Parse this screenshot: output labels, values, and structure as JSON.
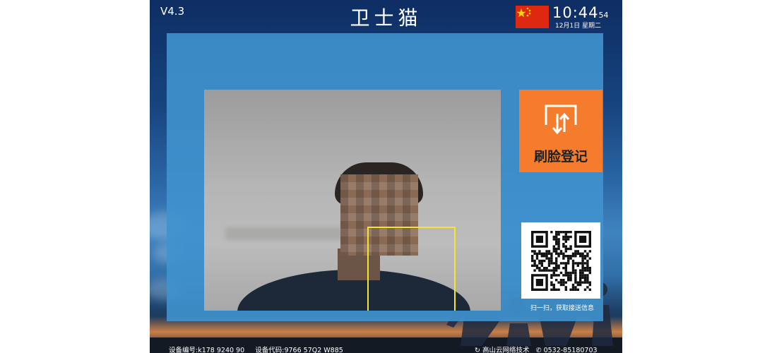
{
  "header": {
    "version": "V4.3",
    "title": "卫士猫",
    "clock": {
      "time": "10:44",
      "seconds": "54",
      "date": "12月1日 星期二"
    }
  },
  "camera": {
    "face_box_color": "#f5e52e"
  },
  "actions": {
    "register_label": "刷脸登记",
    "register_color": "#f47c2c"
  },
  "qr": {
    "caption": "扫一扫，获取接送信息"
  },
  "footer": {
    "device_no": "设备编号:k178 9240 90",
    "device_code": "设备代码:9766 57Q2 W885",
    "company": "高山云网络技术",
    "phone": "0532-85180703"
  }
}
